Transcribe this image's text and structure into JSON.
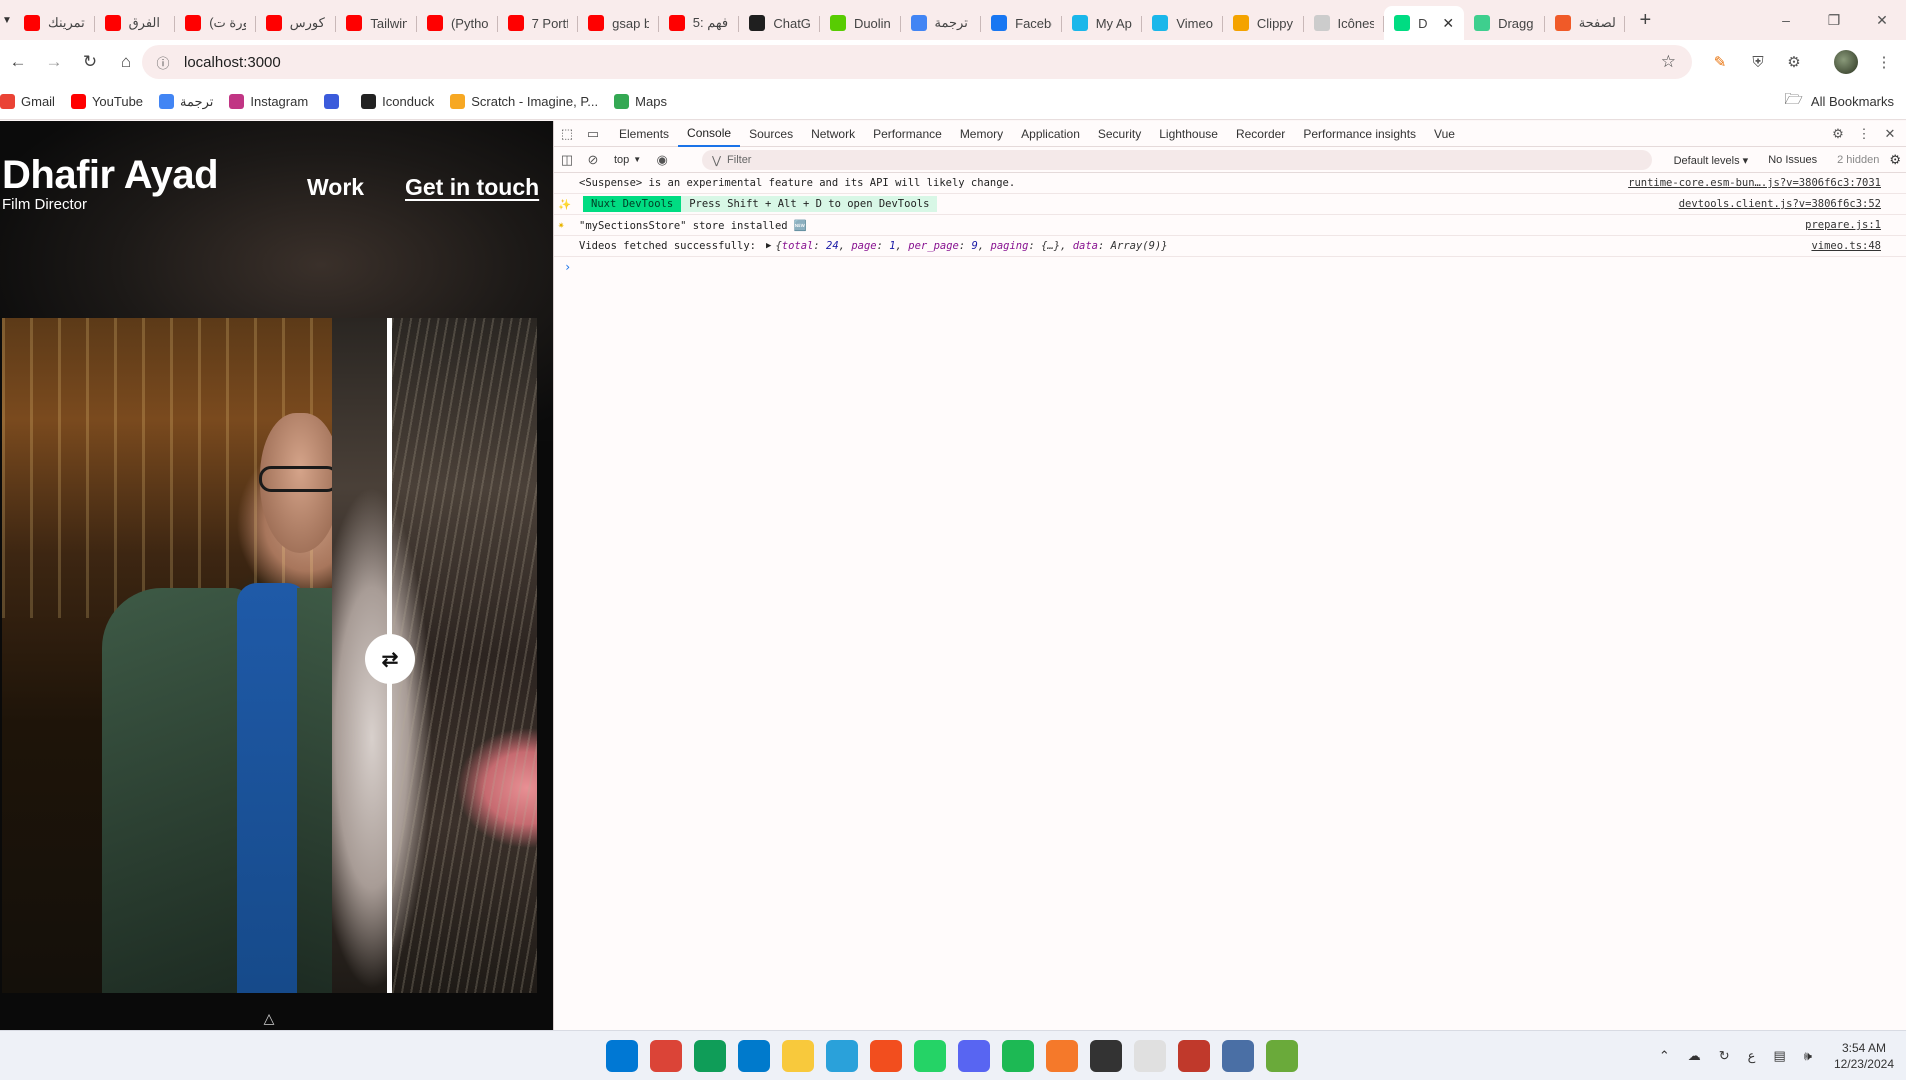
{
  "browser": {
    "tabs": [
      {
        "title": "تمرينك",
        "icon": "youtube-icon",
        "color": "#ff0000"
      },
      {
        "title": "الفرق",
        "icon": "youtube-icon",
        "color": "#ff0000"
      },
      {
        "title": "(دورة ت",
        "icon": "youtube-icon",
        "color": "#ff0000"
      },
      {
        "title": "كورس",
        "icon": "youtube-icon",
        "color": "#ff0000"
      },
      {
        "title": "Tailwin",
        "icon": "youtube-icon",
        "color": "#ff0000"
      },
      {
        "title": "(Pytho",
        "icon": "youtube-icon",
        "color": "#ff0000"
      },
      {
        "title": "7 Portf",
        "icon": "youtube-icon",
        "color": "#ff0000"
      },
      {
        "title": "gsap b",
        "icon": "youtube-icon",
        "color": "#ff0000"
      },
      {
        "title": "5: فهم",
        "icon": "youtube-icon",
        "color": "#ff0000"
      },
      {
        "title": "ChatGI",
        "icon": "chatgpt-icon",
        "color": "#1f1f1f"
      },
      {
        "title": "Duolin",
        "icon": "duolingo-icon",
        "color": "#58cc02"
      },
      {
        "title": "ترجمة",
        "icon": "translate-icon",
        "color": "#4285f4"
      },
      {
        "title": "Facebo",
        "icon": "facebook-icon",
        "color": "#1877f2"
      },
      {
        "title": "My Ap",
        "icon": "vimeo-icon",
        "color": "#1ab7ea"
      },
      {
        "title": "Vimeo",
        "icon": "vimeo-icon",
        "color": "#1ab7ea"
      },
      {
        "title": "Clippy",
        "icon": "clippy-icon",
        "color": "#f4a300"
      },
      {
        "title": "Icônes",
        "icon": "icones-icon",
        "color": "#cccccc"
      },
      {
        "title": "D",
        "icon": "nuxt-icon",
        "color": "#00dc82",
        "active": true
      },
      {
        "title": "Dragg",
        "icon": "dragg-icon",
        "color": "#3ecf8e"
      },
      {
        "title": "الصفحة",
        "icon": "page-icon",
        "color": "#f05a28"
      }
    ],
    "new_tab": "+",
    "url": "localhost:3000",
    "bookmarks": [
      {
        "label": "Gmail",
        "icon": "gmail-icon",
        "color": "#ea4335"
      },
      {
        "label": "YouTube",
        "icon": "youtube-icon",
        "color": "#ff0000"
      },
      {
        "label": "ترجمة",
        "icon": "translate-icon",
        "color": "#4285f4"
      },
      {
        "label": "Instagram",
        "icon": "instagram-icon",
        "color": "#c13584"
      },
      {
        "label": "",
        "icon": "globe-icon",
        "color": "#3b5bdb"
      },
      {
        "label": "Iconduck",
        "icon": "iconduck-icon",
        "color": "#222222"
      },
      {
        "label": "Scratch - Imagine, P...",
        "icon": "scratch-icon",
        "color": "#f7a823"
      },
      {
        "label": "Maps",
        "icon": "maps-icon",
        "color": "#34a853"
      }
    ],
    "all_bookmarks": "All Bookmarks"
  },
  "site": {
    "title": "Dhafir Ayad",
    "subtitle": "Film Director",
    "nav_work": "Work",
    "nav_contact": "Get in touch",
    "compare_position": 0.72
  },
  "devtools": {
    "tabs": [
      "Elements",
      "Console",
      "Sources",
      "Network",
      "Performance",
      "Memory",
      "Application",
      "Security",
      "Lighthouse",
      "Recorder",
      "Performance insights",
      "Vue"
    ],
    "active_tab": "Console",
    "context": "top",
    "filter_placeholder": "Filter",
    "levels": "Default levels",
    "issues": "No Issues",
    "hidden": "2 hidden",
    "logs": [
      {
        "text": "<Suspense> is an experimental feature and its API will likely change.",
        "source": "runtime-core.esm-bun….js?v=3806f6c3:7031"
      },
      {
        "tag": "Nuxt DevTools",
        "hint": "Press Shift + Alt + D to open DevTools",
        "source": "devtools.client.js?v=3806f6c3:52"
      },
      {
        "text": "\"mySectionsStore\" store installed 🆕",
        "source": "prepare.js:1"
      },
      {
        "prefix": "Videos fetched successfully:",
        "source": "vimeo.ts:48",
        "object": {
          "total": "24",
          "page": "1",
          "per_page": "9",
          "paging": "{…}",
          "data": "Array(9)"
        }
      }
    ]
  },
  "taskbar": {
    "apps": [
      {
        "icon": "windows-start-icon",
        "color": "#0078d4"
      },
      {
        "icon": "chrome-icon",
        "color": "#db4437"
      },
      {
        "icon": "chrome-profile-icon",
        "color": "#0f9d58"
      },
      {
        "icon": "vscode-icon",
        "color": "#007acc"
      },
      {
        "icon": "file-explorer-icon",
        "color": "#f8c93c"
      },
      {
        "icon": "telegram-icon",
        "color": "#2aa1da"
      },
      {
        "icon": "figma-icon",
        "color": "#f24e1e"
      },
      {
        "icon": "whatsapp-icon",
        "color": "#25d366"
      },
      {
        "icon": "discord-icon",
        "color": "#5865f2"
      },
      {
        "icon": "spotify-icon",
        "color": "#1db954"
      },
      {
        "icon": "blender-icon",
        "color": "#f5792a"
      },
      {
        "icon": "github-desktop-icon",
        "color": "#333333"
      },
      {
        "icon": "notepad-icon",
        "color": "#e0e0e0"
      },
      {
        "icon": "snipping-tool-icon",
        "color": "#c0392b"
      },
      {
        "icon": "calculator-icon",
        "color": "#4a6fa5"
      },
      {
        "icon": "app-icon",
        "color": "#6aaa3a"
      }
    ],
    "tray_lang": "ع",
    "time": "3:54 AM",
    "date": "12/23/2024"
  }
}
